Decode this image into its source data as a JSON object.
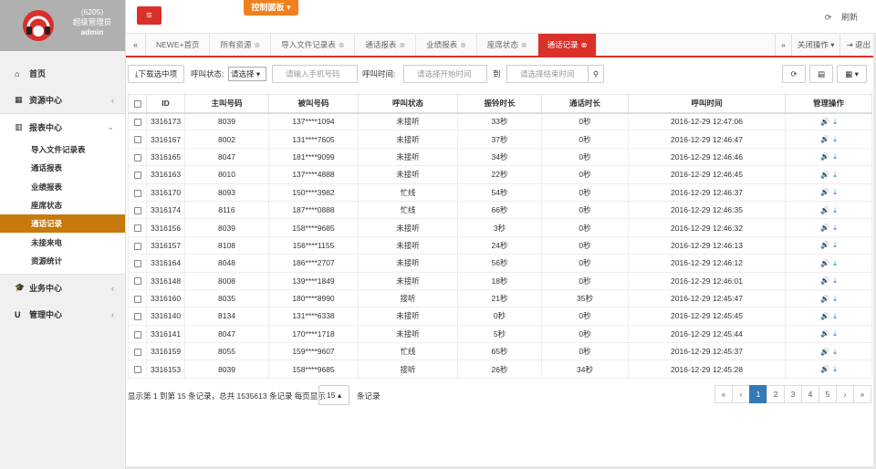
{
  "profile": {
    "ext": "(6205)",
    "role": "超级管理员",
    "name": "admin"
  },
  "sidebar": {
    "items": [
      {
        "label": "首页",
        "icon": "home-icon"
      },
      {
        "label": "资源中心",
        "icon": "table-icon"
      },
      {
        "label": "报表中心",
        "icon": "bar-chart-icon"
      },
      {
        "label": "业务中心",
        "icon": "graduation-cap-icon"
      },
      {
        "label": "管理中心",
        "icon": "magnet-icon"
      }
    ],
    "sub_items": [
      "导入文件记录表",
      "通话报表",
      "业绩报表",
      "座席状态",
      "通话记录",
      "未接来电",
      "资源统计"
    ]
  },
  "topbar": {
    "panel_label": "控制面板",
    "refresh_label": "刷新"
  },
  "tabs": [
    {
      "label": "NEWE+首页",
      "closable": false
    },
    {
      "label": "所有资源",
      "closable": true
    },
    {
      "label": "导入文件记录表",
      "closable": true
    },
    {
      "label": "通话报表",
      "closable": true
    },
    {
      "label": "业绩报表",
      "closable": true
    },
    {
      "label": "座席状态",
      "closable": true
    },
    {
      "label": "通话记录",
      "closable": true,
      "active": true
    }
  ],
  "tabs_right": {
    "close_ops": "关闭操作",
    "logout": "退出"
  },
  "toolbar": {
    "download_label": "下载选中项",
    "status_label": "呼叫状态:",
    "status_select": "请选择",
    "phone_placeholder": "请输入手机号码",
    "time_label": "呼叫时间:",
    "start_placeholder": "请选择开始时间",
    "to_label": "到",
    "end_placeholder": "请选择结束时间"
  },
  "table": {
    "headers": [
      "ID",
      "主叫号码",
      "被叫号码",
      "呼叫状态",
      "振铃时长",
      "通话时长",
      "呼叫时间",
      "管理操作"
    ],
    "rows": [
      [
        "3316173",
        "8039",
        "137****1094",
        "未接听",
        "33秒",
        "0秒",
        "2016-12-29 12:47:06"
      ],
      [
        "3316167",
        "8002",
        "131****7605",
        "未接听",
        "37秒",
        "0秒",
        "2016-12-29 12:46:47"
      ],
      [
        "3316165",
        "8047",
        "181****9099",
        "未接听",
        "34秒",
        "0秒",
        "2016-12-29 12:46:46"
      ],
      [
        "3316163",
        "8010",
        "137****4888",
        "未接听",
        "22秒",
        "0秒",
        "2016-12-29 12:46:45"
      ],
      [
        "3316170",
        "8093",
        "150****3982",
        "忙线",
        "54秒",
        "0秒",
        "2016-12-29 12:46:37"
      ],
      [
        "3316174",
        "8116",
        "187****0888",
        "忙线",
        "66秒",
        "0秒",
        "2016-12-29 12:46:35"
      ],
      [
        "3316156",
        "8039",
        "158****9685",
        "未接听",
        "3秒",
        "0秒",
        "2016-12-29 12:46:32"
      ],
      [
        "3316157",
        "8108",
        "156****1155",
        "未接听",
        "24秒",
        "0秒",
        "2016-12-29 12:46:13"
      ],
      [
        "3316164",
        "8048",
        "186****2707",
        "未接听",
        "56秒",
        "0秒",
        "2016-12-29 12:46:12"
      ],
      [
        "3316148",
        "8008",
        "139****1849",
        "未接听",
        "18秒",
        "0秒",
        "2016-12-29 12:46:01"
      ],
      [
        "3316160",
        "8035",
        "180****8990",
        "接听",
        "21秒",
        "35秒",
        "2016-12-29 12:45:47"
      ],
      [
        "3316140",
        "8134",
        "131****6338",
        "未接听",
        "0秒",
        "0秒",
        "2016-12-29 12:45:45"
      ],
      [
        "3316141",
        "8047",
        "170****1718",
        "未接听",
        "5秒",
        "0秒",
        "2016-12-29 12:45:44"
      ],
      [
        "3316159",
        "8055",
        "159****9607",
        "忙线",
        "65秒",
        "0秒",
        "2016-12-29 12:45:37"
      ],
      [
        "3316153",
        "8039",
        "158****9685",
        "接听",
        "26秒",
        "34秒",
        "2016-12-29 12:45:28"
      ]
    ]
  },
  "footer": {
    "info": "显示第 1 到第 15 条记录，总共 1535613 条记录 每页显示",
    "page_size": "15",
    "after": "条记录",
    "pages": [
      "«",
      "‹",
      "1",
      "2",
      "3",
      "4",
      "5",
      "›",
      "»"
    ],
    "active_page": "1"
  }
}
